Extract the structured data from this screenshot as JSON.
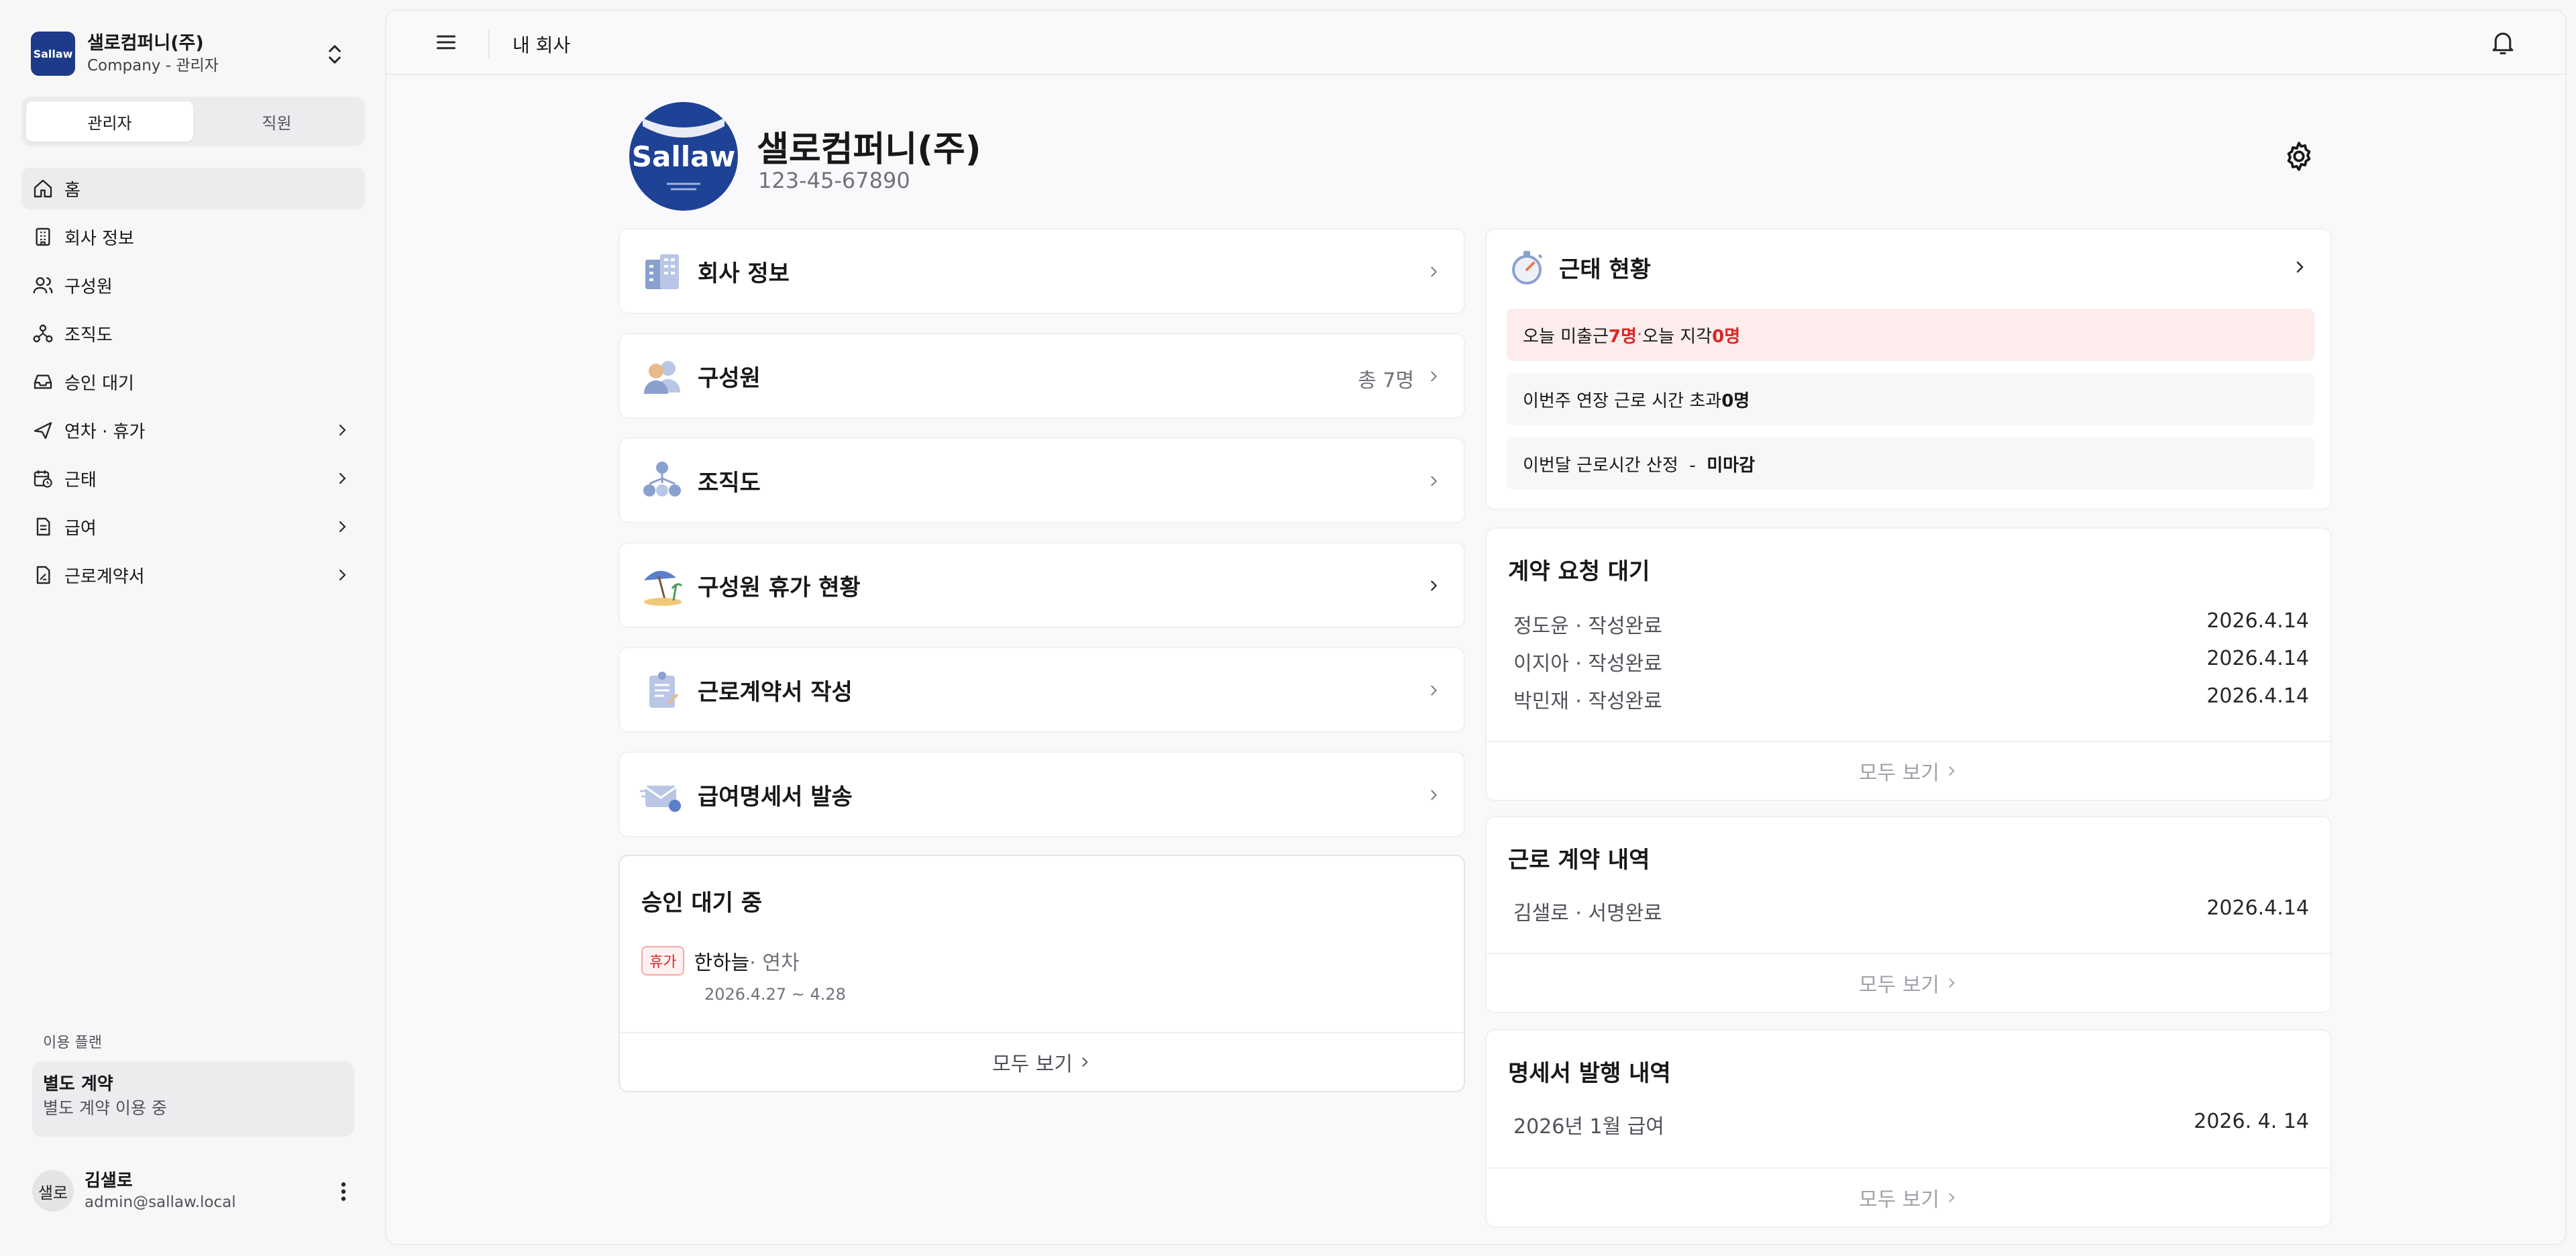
{
  "sidebar": {
    "company_logo_text": "Sallaw",
    "company_name": "샐로컴퍼니(주)",
    "company_role": "Company - 관리자",
    "role_tabs": [
      "관리자",
      "직원"
    ],
    "nav": [
      {
        "label": "홈",
        "icon": "home-icon"
      },
      {
        "label": "회사 정보",
        "icon": "building-icon"
      },
      {
        "label": "구성원",
        "icon": "users-icon"
      },
      {
        "label": "조직도",
        "icon": "org-chart-icon"
      },
      {
        "label": "승인 대기",
        "icon": "inbox-icon"
      },
      {
        "label": "연차 · 휴가",
        "icon": "plane-icon"
      },
      {
        "label": "근태",
        "icon": "calendar-clock-icon"
      },
      {
        "label": "급여",
        "icon": "document-icon"
      },
      {
        "label": "근로계약서",
        "icon": "contract-icon"
      }
    ],
    "plan_label": "이용 플랜",
    "plan_title": "별도 계약",
    "plan_desc": "별도 계약 이용 중",
    "user_avatar": "샐로",
    "user_name": "김샐로",
    "user_email": "admin@sallaw.local"
  },
  "topbar": {
    "title": "내 회사"
  },
  "profile": {
    "logo_text": "Sallaw",
    "name": "샐로컴퍼니(주)",
    "biz_no": "123-45-67890"
  },
  "menu_cards": [
    {
      "label": "회사 정보",
      "meta": ""
    },
    {
      "label": "구성원",
      "meta": "총 7명"
    },
    {
      "label": "조직도",
      "meta": ""
    },
    {
      "label": "구성원 휴가 현황",
      "meta": ""
    },
    {
      "label": "근로계약서 작성",
      "meta": ""
    },
    {
      "label": "급여명세서 발송",
      "meta": ""
    }
  ],
  "approvals": {
    "title": "승인 대기 중",
    "badge": "휴가",
    "name": "한하늘",
    "type": " · 연차",
    "dates": "2026.4.27 ~ 4.28",
    "see_all": "모두 보기"
  },
  "attendance": {
    "title": "근태 현황",
    "row1_a": "오늘 미출근 ",
    "row1_a_val": "7명",
    "row1_sep": " · ",
    "row1_b": "오늘 지각 ",
    "row1_b_val": "0명",
    "row2": "이번주 연장 근로 시간 초과 ",
    "row2_val": "0명",
    "row3": "이번달 근로시간 산정  -  ",
    "row3_val": "미마감"
  },
  "contract_requests": {
    "title": "계약 요청 대기",
    "rows": [
      {
        "name": "정도윤 · 작성완료",
        "date": "2026.4.14"
      },
      {
        "name": "이지아 · 작성완료",
        "date": "2026.4.14"
      },
      {
        "name": "박민재 · 작성완료",
        "date": "2026.4.14"
      }
    ],
    "see_all": "모두 보기"
  },
  "contract_history": {
    "title": "근로 계약 내역",
    "rows": [
      {
        "name": "김샐로 · 서명완료",
        "date": "2026.4.14"
      }
    ],
    "see_all": "모두 보기"
  },
  "payslip_history": {
    "title": "명세서 발행 내역",
    "rows": [
      {
        "name": "2026년 1월 급여",
        "date": "2026. 4. 14"
      }
    ],
    "see_all": "모두 보기"
  }
}
